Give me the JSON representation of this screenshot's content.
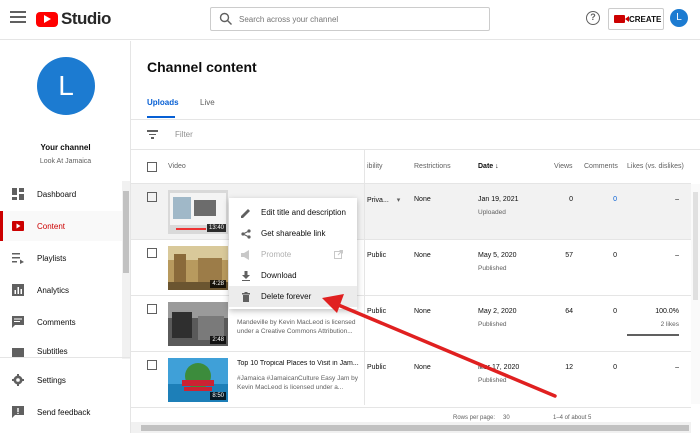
{
  "header": {
    "logo_text": "Studio",
    "search_placeholder": "Search across your channel",
    "create_label": "CREATE",
    "avatar_letter": "L"
  },
  "sidebar": {
    "avatar_letter": "L",
    "channel_title": "Your channel",
    "channel_name": "Look At Jamaica",
    "items": [
      {
        "label": "Dashboard",
        "icon": "dashboard-icon"
      },
      {
        "label": "Content",
        "icon": "content-icon"
      },
      {
        "label": "Playlists",
        "icon": "playlists-icon"
      },
      {
        "label": "Analytics",
        "icon": "analytics-icon"
      },
      {
        "label": "Comments",
        "icon": "comments-icon"
      },
      {
        "label": "Subtitles",
        "icon": "subtitles-icon"
      },
      {
        "label": "Settings",
        "icon": "gear-icon"
      },
      {
        "label": "Send feedback",
        "icon": "feedback-icon"
      }
    ]
  },
  "main": {
    "title": "Channel content",
    "tabs": [
      "Uploads",
      "Live"
    ],
    "filter_placeholder": "Filter",
    "columns": {
      "video": "Video",
      "visibility": "ibility",
      "restrictions": "Restrictions",
      "date": "Date",
      "views": "Views",
      "comments": "Comments",
      "likes": "Likes (vs. dislikes)"
    },
    "rows": [
      {
        "duration": "13:40",
        "title": "",
        "desc1": "",
        "desc2": "",
        "visibility": "Priva...",
        "restrictions": "None",
        "date": "Jan 19, 2021",
        "status": "Uploaded",
        "views": "0",
        "comments": "0",
        "likes": "–",
        "likes_sub": ""
      },
      {
        "duration": "4:28",
        "title": "",
        "desc1": "",
        "desc2": "",
        "visibility": "Public",
        "restrictions": "None",
        "date": "May 5, 2020",
        "status": "Published",
        "views": "57",
        "comments": "0",
        "likes": "–",
        "likes_sub": ""
      },
      {
        "duration": "2:48",
        "title": "",
        "desc1": "Mandeville by Kevin MacLeod is licensed",
        "desc2": "under a Creative Commons Attribution...",
        "visibility": "Public",
        "restrictions": "None",
        "date": "May 2, 2020",
        "status": "Published",
        "views": "64",
        "comments": "0",
        "likes": "100.0%",
        "likes_sub": "2 likes"
      },
      {
        "duration": "8:50",
        "title": "Top 10 Tropical Places to Visit in Jam...",
        "desc1": "#Jamaica #JamaicanCulture Easy Jam by",
        "desc2": "Kevin MacLeod is licensed under a...",
        "visibility": "Public",
        "restrictions": "None",
        "date": "Mar 17, 2020",
        "status": "Published",
        "views": "12",
        "comments": "0",
        "likes": "–",
        "likes_sub": ""
      }
    ],
    "footer": {
      "rows_per_page": "Rows per page:",
      "rows_value": "30",
      "range": "1–4 of about 5"
    }
  },
  "context_menu": {
    "items": [
      {
        "label": "Edit title and description",
        "icon": "pencil-icon"
      },
      {
        "label": "Get shareable link",
        "icon": "share-icon"
      },
      {
        "label": "Promote",
        "icon": "megaphone-icon"
      },
      {
        "label": "Download",
        "icon": "download-icon"
      },
      {
        "label": "Delete forever",
        "icon": "trash-icon"
      }
    ]
  },
  "colors": {
    "brand_red": "#ff0000",
    "accent_blue": "#065fd4",
    "avatar_blue": "#1c7bd1",
    "annotation_red": "#e02020"
  }
}
